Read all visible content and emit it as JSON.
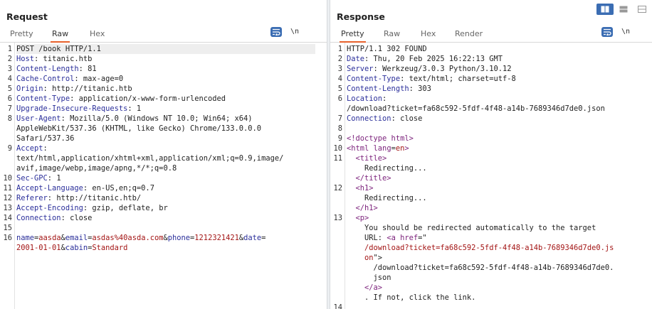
{
  "request": {
    "title": "Request",
    "tabs": [
      "Pretty",
      "Raw",
      "Hex"
    ],
    "active_tab": "Raw",
    "newline_toggle": "\\n",
    "lines": [
      {
        "n": "1",
        "text": "POST /book HTTP/1.1"
      },
      {
        "n": "2",
        "key": "Host",
        "value": "titanic.htb"
      },
      {
        "n": "3",
        "key": "Content-Length",
        "value": "81"
      },
      {
        "n": "4",
        "key": "Cache-Control",
        "value": "max-age=0"
      },
      {
        "n": "5",
        "key": "Origin",
        "value": "http://titanic.htb"
      },
      {
        "n": "6",
        "key": "Content-Type",
        "value": "application/x-www-form-urlencoded"
      },
      {
        "n": "7",
        "key": "Upgrade-Insecure-Requests",
        "value": "1"
      },
      {
        "n": "8",
        "key": "User-Agent",
        "value": "Mozilla/5.0 (Windows NT 10.0; Win64; x64)"
      },
      {
        "n": "",
        "text": "AppleWebKit/537.36 (KHTML, like Gecko) Chrome/133.0.0.0"
      },
      {
        "n": "",
        "text": "Safari/537.36"
      },
      {
        "n": "9",
        "key": "Accept",
        "value": ""
      },
      {
        "n": "",
        "text": "text/html,application/xhtml+xml,application/xml;q=0.9,image/"
      },
      {
        "n": "",
        "text": "avif,image/webp,image/apng,*/*;q=0.8"
      },
      {
        "n": "10",
        "key": "Sec-GPC",
        "value": "1"
      },
      {
        "n": "11",
        "key": "Accept-Language",
        "value": "en-US,en;q=0.7"
      },
      {
        "n": "12",
        "key": "Referer",
        "value": "http://titanic.htb/"
      },
      {
        "n": "13",
        "key": "Accept-Encoding",
        "value": "gzip, deflate, br"
      },
      {
        "n": "14",
        "key": "Connection",
        "value": "close"
      },
      {
        "n": "15",
        "text": ""
      },
      {
        "n": "16",
        "parts": [
          {
            "c": "pn",
            "t": "name"
          },
          {
            "c": "",
            "t": "="
          },
          {
            "c": "pv",
            "t": "aasda"
          },
          {
            "c": "",
            "t": "&"
          },
          {
            "c": "pn",
            "t": "email"
          },
          {
            "c": "",
            "t": "="
          },
          {
            "c": "pv",
            "t": "asdas%40asda.com"
          },
          {
            "c": "",
            "t": "&"
          },
          {
            "c": "pn",
            "t": "phone"
          },
          {
            "c": "",
            "t": "="
          },
          {
            "c": "pv",
            "t": "1212321421"
          },
          {
            "c": "",
            "t": "&"
          },
          {
            "c": "pn",
            "t": "date"
          },
          {
            "c": "",
            "t": "="
          }
        ]
      },
      {
        "n": "",
        "parts": [
          {
            "c": "pv",
            "t": "2001-01-01"
          },
          {
            "c": "",
            "t": "&"
          },
          {
            "c": "pn",
            "t": "cabin"
          },
          {
            "c": "",
            "t": "="
          },
          {
            "c": "pv",
            "t": "Standard"
          }
        ]
      }
    ]
  },
  "response": {
    "title": "Response",
    "tabs": [
      "Pretty",
      "Raw",
      "Hex",
      "Render"
    ],
    "active_tab": "Pretty",
    "newline_toggle": "\\n",
    "lines": [
      {
        "n": "1",
        "text": "HTTP/1.1 302 FOUND"
      },
      {
        "n": "2",
        "key": "Date",
        "value": "Thu, 20 Feb 2025 16:22:13 GMT"
      },
      {
        "n": "3",
        "key": "Server",
        "value": "Werkzeug/3.0.3 Python/3.10.12"
      },
      {
        "n": "4",
        "key": "Content-Type",
        "value": "text/html; charset=utf-8"
      },
      {
        "n": "5",
        "key": "Content-Length",
        "value": "303"
      },
      {
        "n": "6",
        "key": "Location",
        "value": ""
      },
      {
        "n": "",
        "text": "/download?ticket=fa68c592-5fdf-4f48-a14b-7689346d7de0.json"
      },
      {
        "n": "7",
        "key": "Connection",
        "value": "close"
      },
      {
        "n": "8",
        "text": ""
      },
      {
        "n": "9",
        "parts": [
          {
            "c": "tg",
            "t": "<!doctype html>"
          }
        ]
      },
      {
        "n": "10",
        "parts": [
          {
            "c": "tg",
            "t": "<html "
          },
          {
            "c": "tg",
            "t": "lang"
          },
          {
            "c": "",
            "t": "="
          },
          {
            "c": "av",
            "t": "en"
          },
          {
            "c": "tg",
            "t": ">"
          }
        ]
      },
      {
        "n": "11",
        "parts": [
          {
            "c": "",
            "t": "  "
          },
          {
            "c": "tg",
            "t": "<title>"
          }
        ]
      },
      {
        "n": "",
        "text": "    Redirecting..."
      },
      {
        "n": "",
        "parts": [
          {
            "c": "",
            "t": "  "
          },
          {
            "c": "tg",
            "t": "</title>"
          }
        ]
      },
      {
        "n": "12",
        "parts": [
          {
            "c": "",
            "t": "  "
          },
          {
            "c": "tg",
            "t": "<h1>"
          }
        ]
      },
      {
        "n": "",
        "text": "    Redirecting..."
      },
      {
        "n": "",
        "parts": [
          {
            "c": "",
            "t": "  "
          },
          {
            "c": "tg",
            "t": "</h1>"
          }
        ]
      },
      {
        "n": "13",
        "parts": [
          {
            "c": "",
            "t": "  "
          },
          {
            "c": "tg",
            "t": "<p>"
          }
        ]
      },
      {
        "n": "",
        "text": "    You should be redirected automatically to the target"
      },
      {
        "n": "",
        "parts": [
          {
            "c": "",
            "t": "    URL: "
          },
          {
            "c": "tg",
            "t": "<a "
          },
          {
            "c": "tg",
            "t": "href"
          },
          {
            "c": "",
            "t": "=\""
          }
        ]
      },
      {
        "n": "",
        "parts": [
          {
            "c": "",
            "t": "    "
          },
          {
            "c": "av",
            "t": "/download?ticket=fa68c592-5fdf-4f48-a14b-7689346d7de0.js"
          }
        ]
      },
      {
        "n": "",
        "parts": [
          {
            "c": "",
            "t": "    "
          },
          {
            "c": "av",
            "t": "on"
          },
          {
            "c": "",
            "t": "\">"
          }
        ]
      },
      {
        "n": "",
        "text": "      /download?ticket=fa68c592-5fdf-4f48-a14b-7689346d7de0."
      },
      {
        "n": "",
        "text": "      json"
      },
      {
        "n": "",
        "parts": [
          {
            "c": "",
            "t": "    "
          },
          {
            "c": "tg",
            "t": "</a>"
          }
        ]
      },
      {
        "n": "",
        "text": "    . If not, click the link."
      },
      {
        "n": "14",
        "text": ""
      }
    ]
  },
  "colors": {
    "accent_blue": "#3b6db3",
    "tab_underline": "#e8612c",
    "header_key": "#2a2e9a",
    "param_value": "#a31515",
    "html_tag": "#7a1f7a"
  },
  "icons": {
    "wrap": "word-wrap-icon",
    "layout": [
      "side-by-side-layout-icon",
      "stacked-horizontal-layout-icon",
      "stacked-vertical-layout-icon"
    ]
  }
}
